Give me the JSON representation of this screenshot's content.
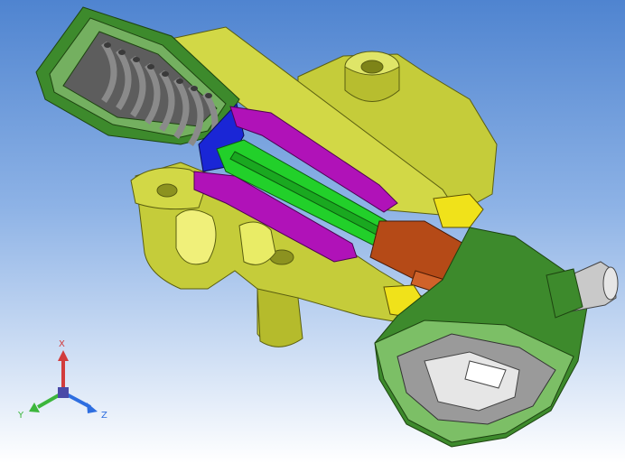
{
  "viewport": {
    "background_top": "#4f84d0",
    "background_bottom": "#ffffff"
  },
  "colors": {
    "housing": "#c5cc3a",
    "housing_light": "#dfe568",
    "housing_dark": "#9aa021",
    "cap": "#3d8a2c",
    "cap_dark": "#2b6a1e",
    "spring": "#8a8a8a",
    "sleeve": "#b012b8",
    "sleeve_dark": "#7d0b86",
    "shaft": "#22d02a",
    "blue_part": "#1a26d6",
    "piston": "#b54a17",
    "nut": "#f0e21a",
    "fitting": "#c9c9c9"
  },
  "triad": {
    "x_label": "X",
    "y_label": "Y",
    "z_label": "Z",
    "x_color": "#d23c3c",
    "y_color": "#3cb63c",
    "z_color": "#2e6ee0",
    "origin_color": "#4a4aa8"
  }
}
